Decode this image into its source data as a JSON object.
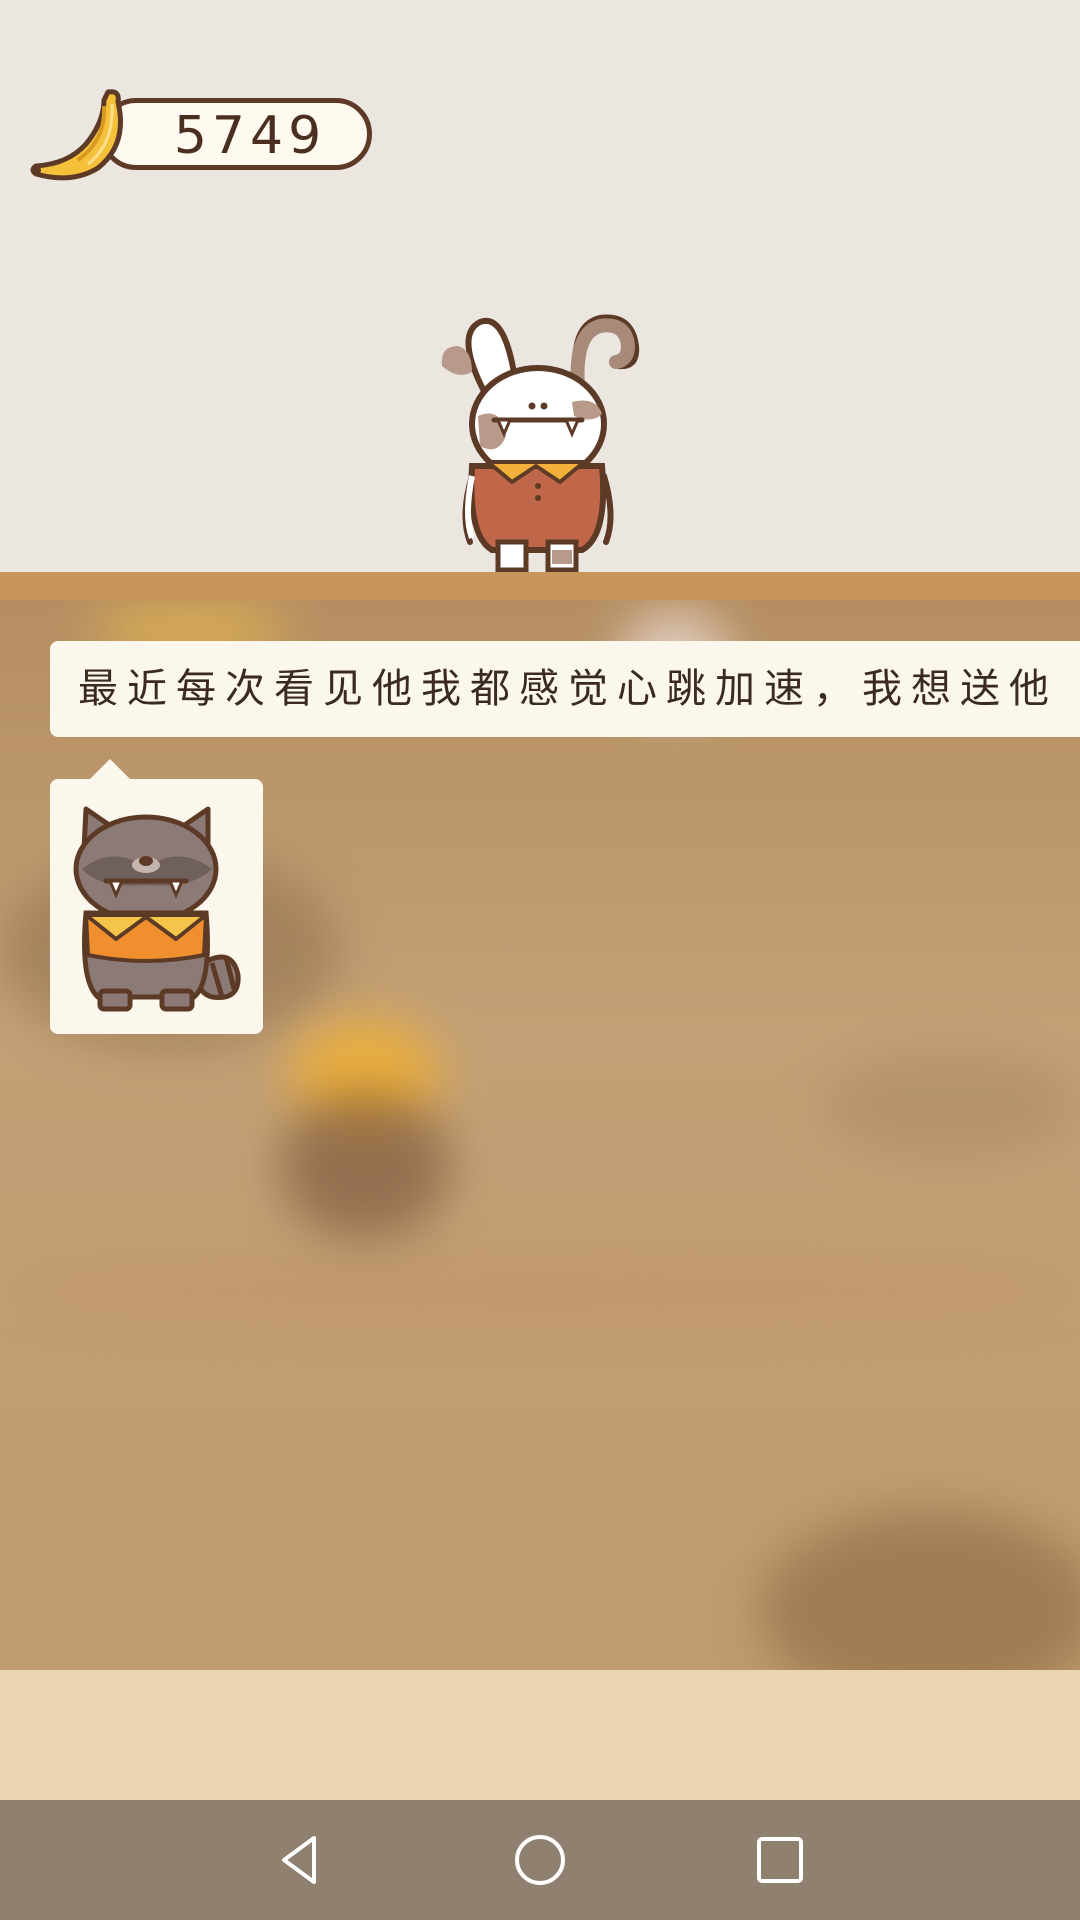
{
  "currency": {
    "icon": "banana-icon",
    "value": "5749"
  },
  "dialog": {
    "text": "最近每次看见他我都感觉心跳加速，我想送他"
  },
  "speaker_portrait": {
    "icon": "raccoon-character"
  },
  "main_character": {
    "icon": "bunny-character"
  },
  "navbar": {
    "back": "back-icon",
    "home": "home-icon",
    "recents": "recents-icon"
  },
  "colors": {
    "background": "#ece6e1",
    "divider": "#c8955a",
    "bubble": "#fcf7ec",
    "bottom_panel": "#ead4b2",
    "navbar": "#8f806f",
    "outline": "#5d3a26"
  }
}
